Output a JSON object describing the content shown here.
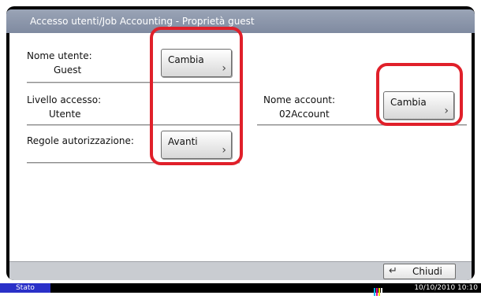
{
  "window": {
    "title": "Accesso utenti/Job Accounting - Proprietà guest"
  },
  "fields": {
    "user_name": {
      "label": "Nome utente:",
      "value": "Guest",
      "button": "Cambia"
    },
    "access_level": {
      "label": "Livello accesso:",
      "value": "Utente"
    },
    "account_name": {
      "label": "Nome account:",
      "value": "02Account",
      "button": "Cambia"
    },
    "auth_rules": {
      "label": "Regole autorizzazione:",
      "button": "Avanti"
    }
  },
  "footer": {
    "close_label": "Chiudi",
    "close_icon": "return-arrow-icon"
  },
  "status_bar": {
    "status_label": "Stato",
    "datetime": "10/10/2010  10:10",
    "toner_colors": [
      "#00b4f0",
      "#e0008c",
      "#f0e000",
      "#111111"
    ]
  },
  "highlight_color": "#e0202a"
}
